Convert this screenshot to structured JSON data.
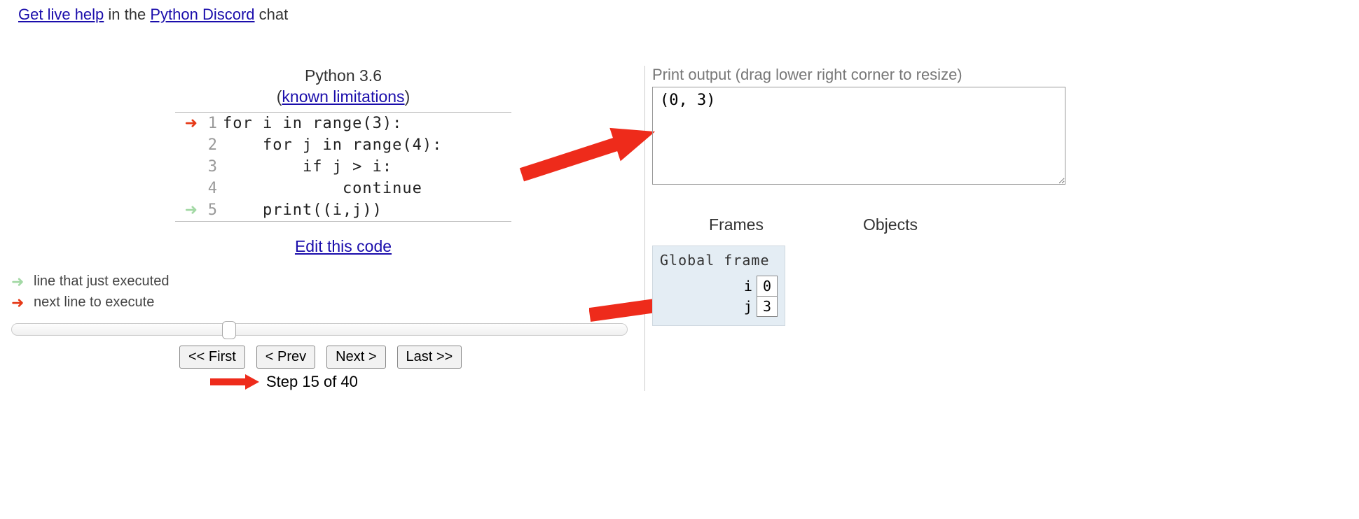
{
  "help_line": {
    "link1": "Get live help",
    "mid": " in the ",
    "link2": "Python Discord",
    "tail": " chat"
  },
  "lang_header": {
    "line1": "Python 3.6",
    "paren_open": "(",
    "link": "known limitations",
    "paren_close": ")"
  },
  "code_lines": [
    {
      "n": "1",
      "text": "for i in range(3):",
      "arrow": "red"
    },
    {
      "n": "2",
      "text": "    for j in range(4):",
      "arrow": ""
    },
    {
      "n": "3",
      "text": "        if j > i:",
      "arrow": ""
    },
    {
      "n": "4",
      "text": "            continue",
      "arrow": ""
    },
    {
      "n": "5",
      "text": "    print((i,j))",
      "arrow": "green"
    }
  ],
  "edit_link": "Edit this code",
  "legend": {
    "executed": "line that just executed",
    "next": "next line to execute"
  },
  "nav": {
    "first": "<< First",
    "prev": "< Prev",
    "next": "Next >",
    "last": "Last >>"
  },
  "step_text": "Step 15 of 40",
  "output": {
    "label": "Print output (drag lower right corner to resize)",
    "text": "(0, 3)"
  },
  "headers": {
    "frames": "Frames",
    "objects": "Objects"
  },
  "global_frame": {
    "title": "Global frame",
    "vars": [
      {
        "k": "i",
        "v": "0"
      },
      {
        "k": "j",
        "v": "3"
      }
    ]
  }
}
